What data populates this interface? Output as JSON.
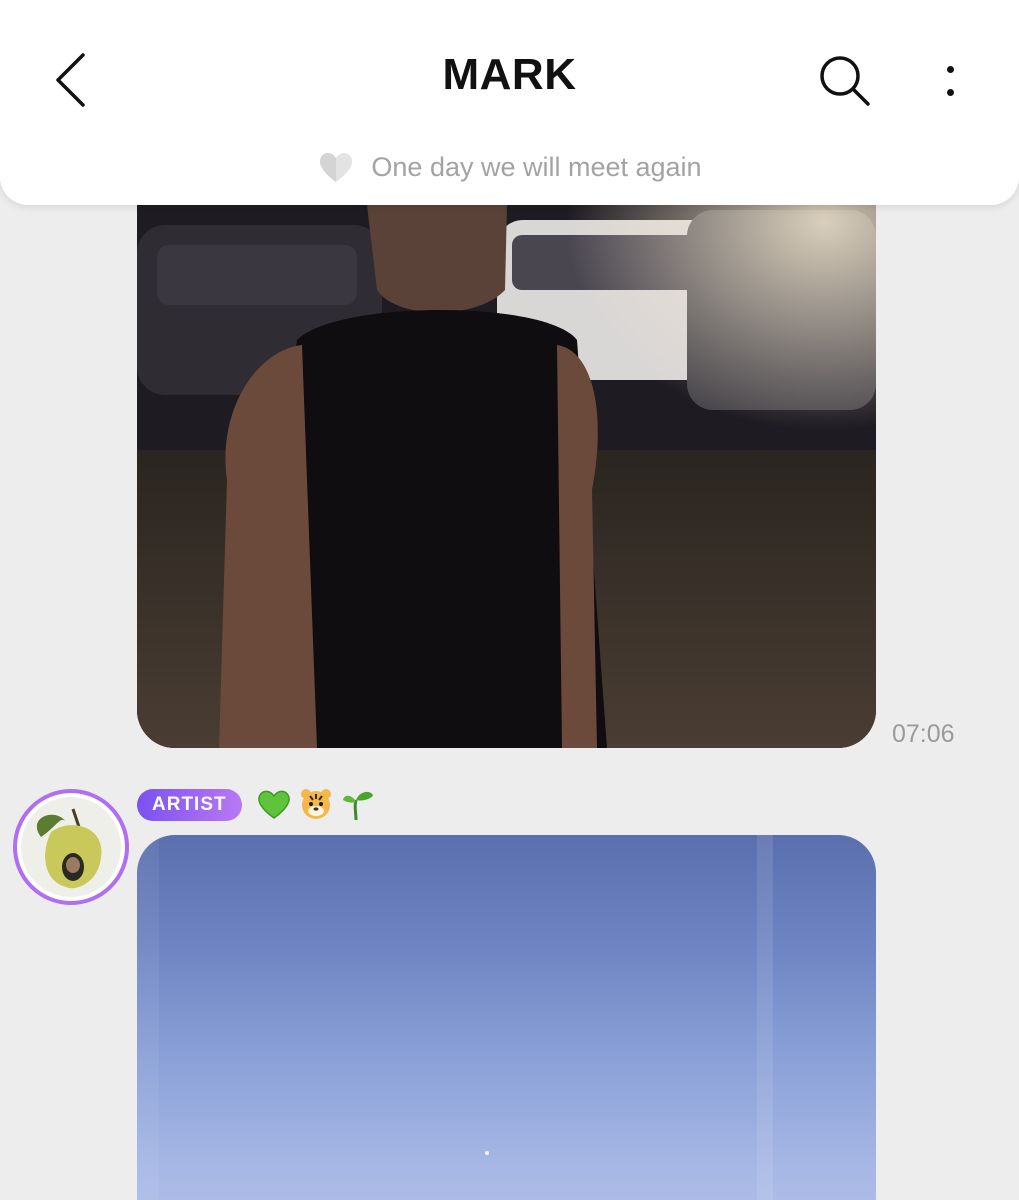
{
  "header": {
    "title": "MARK",
    "status_message": "One day we will meet again",
    "back_icon": "chevron-left-icon",
    "search_icon": "search-icon",
    "more_icon": "vertical-dots-icon"
  },
  "messages": [
    {
      "type": "photo",
      "description_icon": "photo",
      "time": "07:06"
    },
    {
      "type": "photo",
      "sender_badge": "ARTIST",
      "sender_emojis": [
        "green-heart",
        "tiger-face",
        "seedling"
      ]
    }
  ],
  "colors": {
    "background": "#ededed",
    "header": "#ffffff",
    "badge_start": "#7a52f0",
    "badge_end": "#b979f3",
    "avatar_ring": "#b06ef0",
    "muted_text": "#a3a3a3"
  }
}
